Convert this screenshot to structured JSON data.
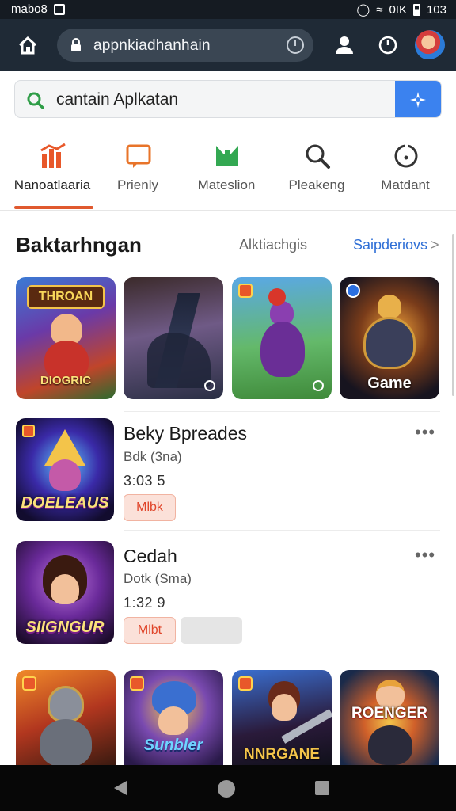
{
  "status_bar": {
    "left_text": "mabo8",
    "right_text": "0IK",
    "time": "103"
  },
  "browser": {
    "url": "appnkiadhanhain"
  },
  "search": {
    "value": "cantain  Aplkatan"
  },
  "categories": [
    {
      "label": "Nanoatlaaria",
      "icon": "bar-chart-icon",
      "color": "#e8582a",
      "active": true
    },
    {
      "label": "Prienly",
      "icon": "chat-icon",
      "color": "#e8742a",
      "active": false
    },
    {
      "label": "Mateslion",
      "icon": "gift-icon",
      "color": "#33a852",
      "active": false
    },
    {
      "label": "Pleakeng",
      "icon": "search-icon",
      "color": "#333333",
      "active": false
    },
    {
      "label": "Matdant",
      "icon": "clock-icon",
      "color": "#333333",
      "active": false
    }
  ],
  "section": {
    "title": "Baktarhngan",
    "middle": "Alktiachgis",
    "link": "Saipderiovs",
    "chevron": ">"
  },
  "featured_tiles": [
    {
      "name": "tile-1",
      "label": "",
      "logo_text": "THROAN",
      "bottom_text": "DIOGRIC"
    },
    {
      "name": "tile-2",
      "label": ""
    },
    {
      "name": "tile-3",
      "label": ""
    },
    {
      "name": "tile-4",
      "label": "Game"
    }
  ],
  "apps": [
    {
      "title": "Beky Bpreades",
      "subtitle": "Bdk  (3na)",
      "number": "3:03 5",
      "chip": "Mlbk",
      "more": "•••",
      "icon_text": "DOELEAUS"
    },
    {
      "title": "Cedah",
      "subtitle": "Dotk (Sma)",
      "number": "1:32 9",
      "chip": "Mlbt",
      "more": "•••",
      "icon_text": "SIIGNGUR"
    }
  ],
  "bottom_tiles": [
    {
      "name": "tile-5",
      "label": ""
    },
    {
      "name": "tile-6",
      "label": "Sunbler"
    },
    {
      "name": "tile-7",
      "label": "NNRGANE"
    },
    {
      "name": "tile-8",
      "label": "ROENGER"
    }
  ],
  "colors": {
    "accent": "#e0592f",
    "link": "#2f6fd6",
    "search_button": "#3b82ef",
    "toolbar": "#1f2a36"
  }
}
